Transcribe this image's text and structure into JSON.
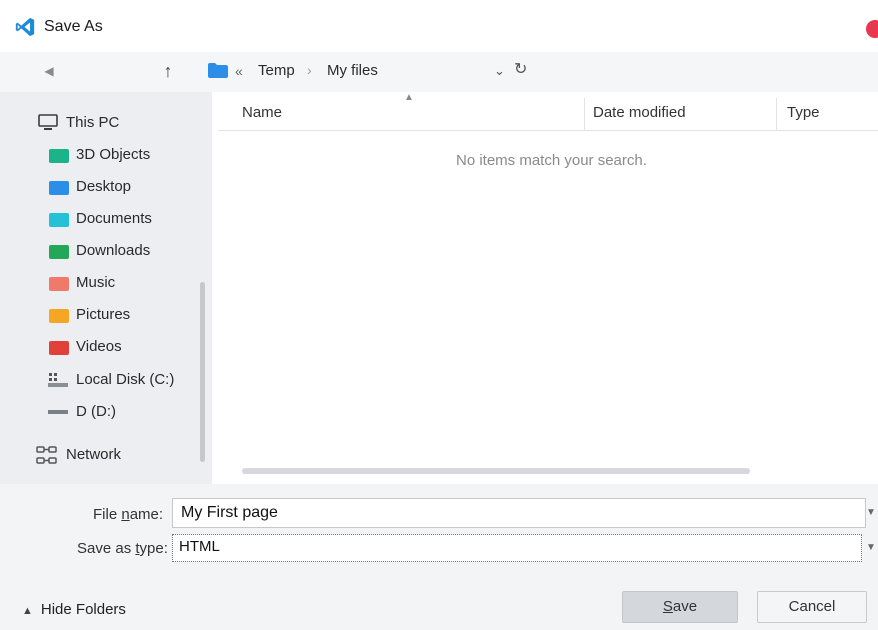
{
  "window": {
    "title": "Save As"
  },
  "breadcrumb": {
    "overflow": "«",
    "items": [
      "Temp",
      "My files"
    ],
    "separator": "›"
  },
  "sidebar": {
    "items": [
      {
        "label": "This PC",
        "icon": "computer-icon"
      },
      {
        "label": "3D Objects",
        "icon": "folder-icon",
        "color": "#1bb38a"
      },
      {
        "label": "Desktop",
        "icon": "folder-icon",
        "color": "#2d8ee8"
      },
      {
        "label": "Documents",
        "icon": "folder-icon",
        "color": "#25c1d6"
      },
      {
        "label": "Downloads",
        "icon": "folder-icon",
        "color": "#23a85a"
      },
      {
        "label": "Music",
        "icon": "folder-icon",
        "color": "#f07a6a"
      },
      {
        "label": "Pictures",
        "icon": "folder-icon",
        "color": "#f5a623"
      },
      {
        "label": "Videos",
        "icon": "folder-icon",
        "color": "#e0413a"
      },
      {
        "label": "Local Disk (C:)",
        "icon": "disk-icon"
      },
      {
        "label": "D (D:)",
        "icon": "drive-icon"
      },
      {
        "label": "Network",
        "icon": "network-icon"
      }
    ]
  },
  "columns": [
    "Name",
    "Date modified",
    "Type"
  ],
  "empty_message": "No items match your search.",
  "form": {
    "file_name_label_pre": "File ",
    "file_name_label_u": "n",
    "file_name_label_post": "ame:",
    "file_name_value": "My First page",
    "save_type_label_pre": "Save as ",
    "save_type_label_u": "t",
    "save_type_label_post": "ype:",
    "save_type_value": "HTML"
  },
  "footer": {
    "hide_folders": "Hide Folders",
    "save_u": "S",
    "save_rest": "ave",
    "cancel": "Cancel"
  },
  "colors": {
    "accent": "#2d8ee8",
    "close": "#e8384f",
    "vscode": "#1f8ad8"
  }
}
